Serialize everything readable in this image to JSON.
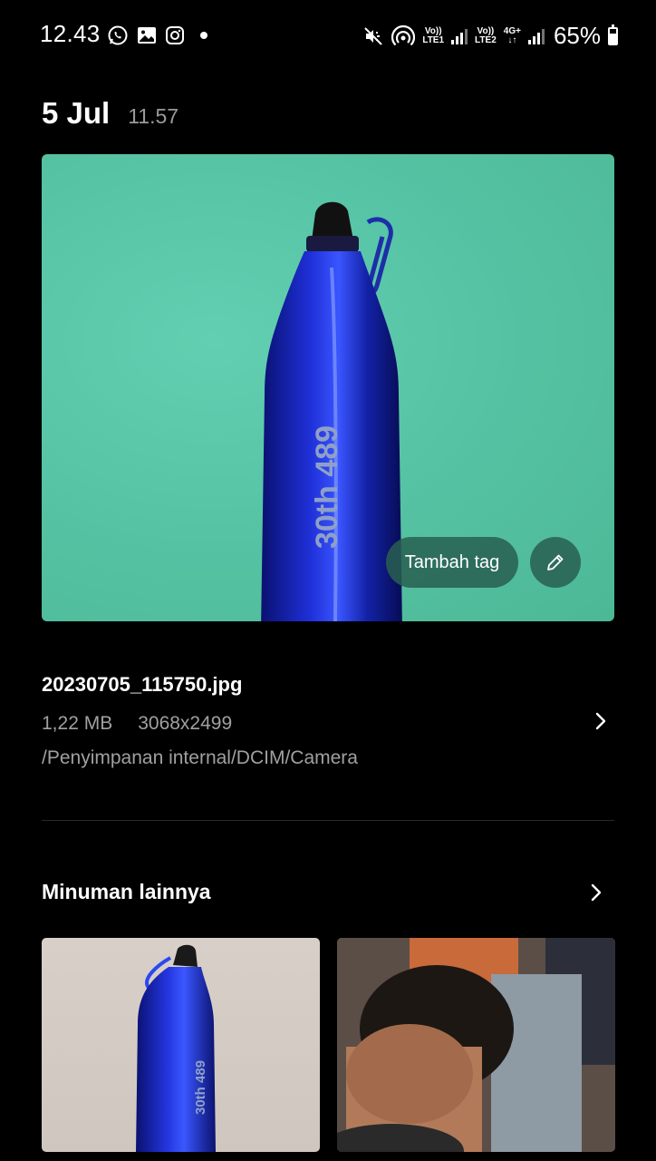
{
  "status_bar": {
    "time": "12.43",
    "left_icons": [
      "whatsapp-icon",
      "gallery-icon",
      "instagram-icon",
      "notification-dot"
    ],
    "right_icons": [
      "mute-icon",
      "hotspot-icon"
    ],
    "sim1": {
      "top": "Vo))",
      "bottom": "LTE1"
    },
    "sim2": {
      "top": "Vo))",
      "bottom": "LTE2"
    },
    "network": "4G+",
    "battery_percent": "65%",
    "battery_level": 0.65
  },
  "header": {
    "date": "5 Jul",
    "time": "11.57"
  },
  "photo": {
    "bottle_text": "30th 489",
    "tag_button_label": "Tambah tag",
    "edit_icon": "pencil-icon",
    "background_color": "#5cc9ab",
    "bottle_color": "#1a2bd0"
  },
  "file": {
    "name": "20230705_115750.jpg",
    "size": "1,22 MB",
    "resolution": "3068x2499",
    "path": "/Penyimpanan internal/DCIM/Camera"
  },
  "related": {
    "title": "Minuman lainnya",
    "thumbnails": [
      {
        "bottle_text": "30th 489"
      },
      {}
    ]
  }
}
